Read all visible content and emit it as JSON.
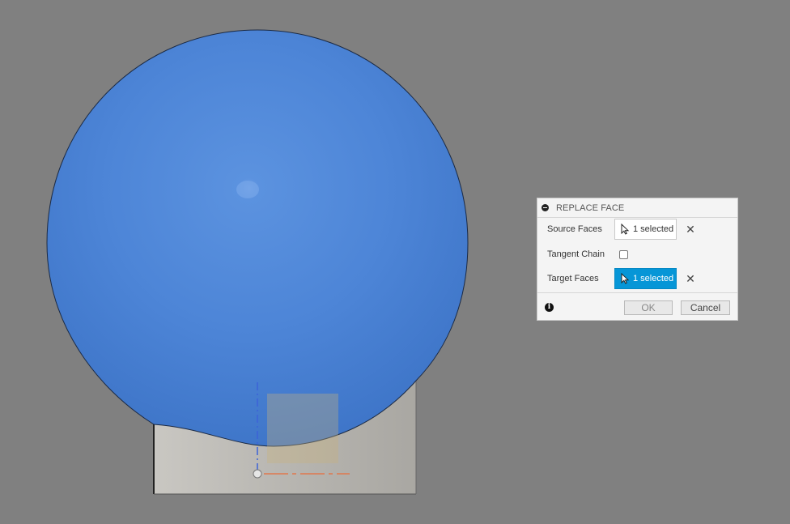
{
  "viewport": {
    "background_color": "#808080",
    "sphere_color": "#4f86d6",
    "body_color": "#b5b3ae"
  },
  "dialog": {
    "title": "REPLACE FACE",
    "collapse_icon": "minus-circle-icon",
    "rows": [
      {
        "label": "Source Faces",
        "selection": "1 selected",
        "state": "idle",
        "icon": "cursor-arrow-icon"
      },
      {
        "label": "Tangent Chain",
        "checked": false
      },
      {
        "label": "Target Faces",
        "selection": "1 selected",
        "state": "active",
        "icon": "cursor-arrow-icon"
      }
    ],
    "clear_icon": "close-icon",
    "info_icon": "info-icon",
    "ok_label": "OK",
    "cancel_label": "Cancel",
    "accent_color": "#0696d7"
  }
}
